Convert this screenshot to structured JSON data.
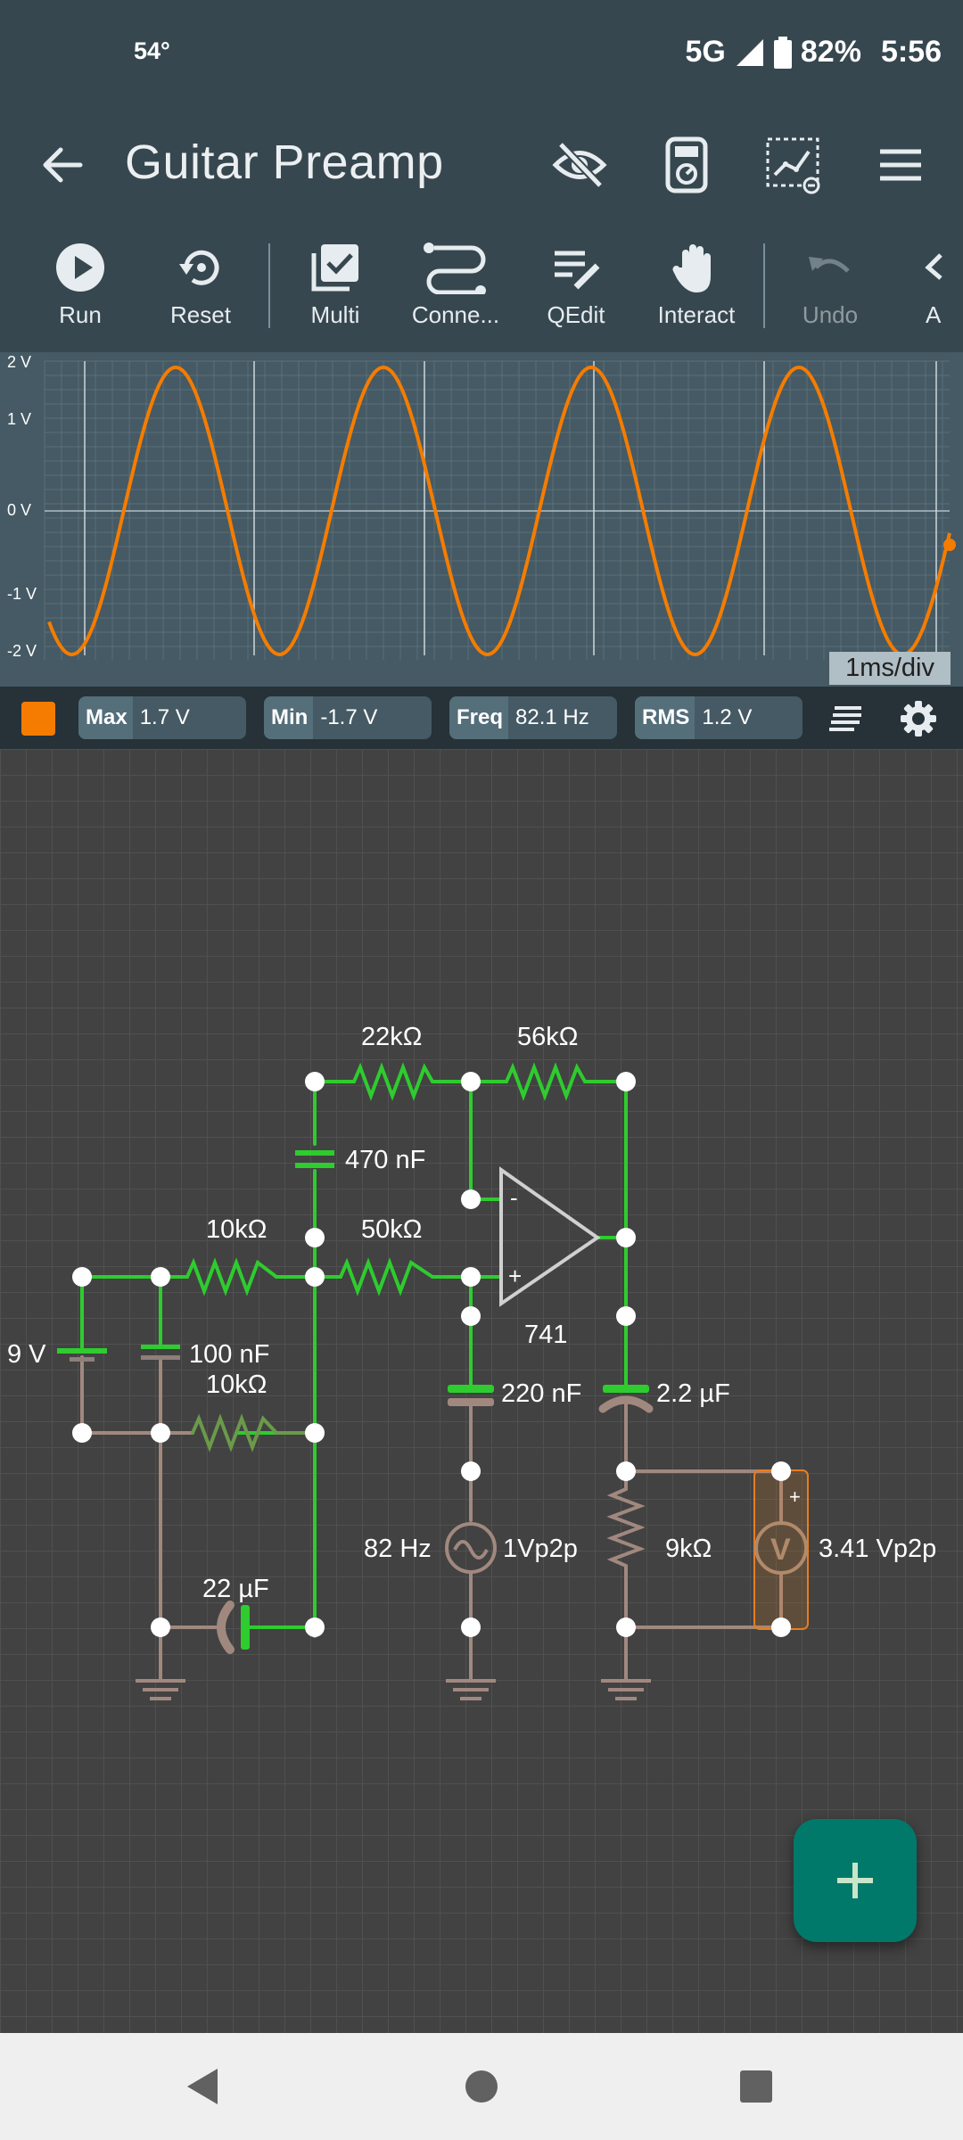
{
  "status_bar": {
    "temperature": "54°",
    "network": "5G",
    "battery": "82%",
    "time": "5:56"
  },
  "app_bar": {
    "title": "Guitar Preamp"
  },
  "toolbar": {
    "items": [
      "Run",
      "Reset",
      "Multi",
      "Conne...",
      "QEdit",
      "Interact",
      "Undo",
      "A"
    ]
  },
  "scope": {
    "y_labels": [
      "2 V",
      "1 V",
      "0 V",
      "-1 V",
      "-2 V"
    ],
    "time_div": "1ms/div",
    "trace_color": "#f57c00"
  },
  "measurements": [
    {
      "key": "Max",
      "value": "1.7 V"
    },
    {
      "key": "Min",
      "value": "-1.7 V"
    },
    {
      "key": "Freq",
      "value": "82.1 Hz"
    },
    {
      "key": "RMS",
      "value": "1.2 V"
    }
  ],
  "circuit": {
    "r_22k": "22kΩ",
    "r_56k": "56kΩ",
    "c_470n": "470 nF",
    "r_10k_top": "10kΩ",
    "r_50k": "50kΩ",
    "battery": "9 V",
    "c_100n": "100 nF",
    "r_10k_bottom": "10kΩ",
    "opamp": "741",
    "c_220n": "220 nF",
    "c_2u2": "2.2 µF",
    "source_freq": "82 Hz",
    "source_amp": "1Vp2p",
    "r_9k": "9kΩ",
    "meter_reading": "3.41 Vp2p",
    "c_22u": "22 µF",
    "opamp_minus": "-",
    "opamp_plus": "+",
    "meter_plus": "+",
    "meter_letter": "V"
  },
  "colors": {
    "active_wire": "#2ecc2e",
    "inactive_wire": "#a1887f",
    "accent": "#00796b"
  }
}
